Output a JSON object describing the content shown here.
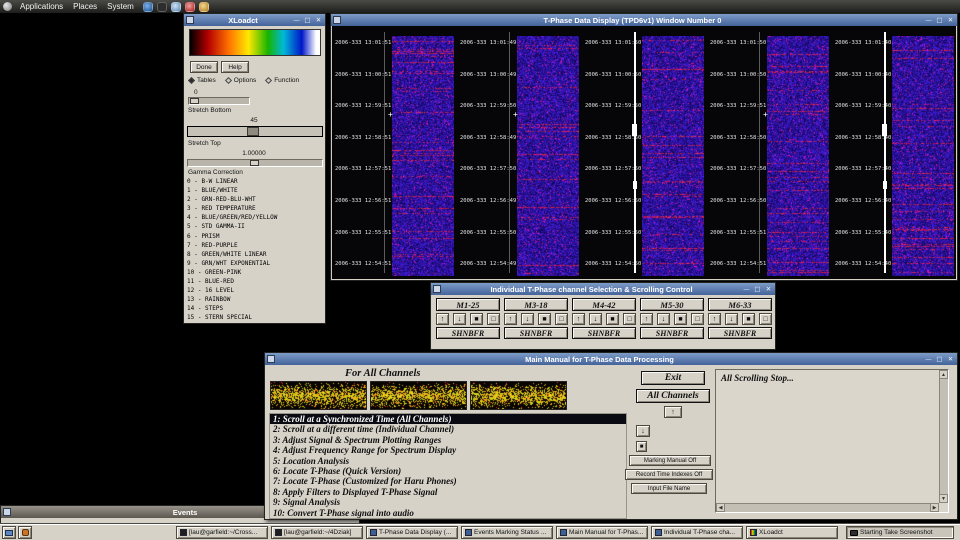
{
  "colors": {
    "titlebar_active": "#43639a",
    "titlebar_inactive": "#6e6a62",
    "window_bg": "#d6d2c8",
    "desktop": "#000000",
    "selection_bg": "#0a0a12",
    "spectrogram_base": "#2020a0",
    "spectrogram_hot": "#cc2040"
  },
  "icons": {
    "minimize": "—",
    "maximize": "□",
    "close": "✕",
    "up": "↑",
    "down": "↓",
    "stop": "■",
    "square": "□",
    "scroll_up": "▲",
    "scroll_down": "▼",
    "scroll_left": "◀",
    "scroll_right": "▶"
  },
  "menubar": {
    "menus": [
      "Applications",
      "Places",
      "System"
    ]
  },
  "xloadct": {
    "title": "XLoadct",
    "done_label": "Done",
    "help_label": "Help",
    "radio_tables": "Tables",
    "radio_options": "Options",
    "radio_function": "Function",
    "stretch_bottom_value": "0",
    "stretch_bottom_label": "Stretch Bottom",
    "stretch_top_value": "45",
    "stretch_top_label": "Stretch Top",
    "gamma_value": "1.00000",
    "gamma_label": "Gamma Correction",
    "color_tables": [
      "0 - B-W LINEAR",
      "1 - BLUE/WHITE",
      "2 - GRN-RED-BLU-WHT",
      "3 - RED TEMPERATURE",
      "4 - BLUE/GREEN/RED/YELLOW",
      "5 - STD GAMMA-II",
      "6 - PRISM",
      "7 - RED-PURPLE",
      "8 - GREEN/WHITE LINEAR",
      "9 - GRN/WHT EXPONENTIAL",
      "10 - GREEN-PINK",
      "11 - BLUE-RED",
      "12 - 16 LEVEL",
      "13 - RAINBOW",
      "14 - STEPS",
      "15 - STERN SPECIAL"
    ]
  },
  "tpd": {
    "title": "T-Phase Data Display (TPD6v1) Window Number 0",
    "channels": [
      {
        "times": [
          "2006-333 13:01:51",
          "2006-333 13:00:51",
          "2006-333 12:59:51",
          "2006-333 12:58:51",
          "2006-333 12:57:51",
          "2006-333 12:56:51",
          "2006-333 12:55:51",
          "2006-333 12:54:51"
        ]
      },
      {
        "times": [
          "2006-333 13:01:49",
          "2006-333 13:00:49",
          "2006-333 12:59:50",
          "2006-333 12:58:49",
          "2006-333 12:57:50",
          "2006-333 12:56:49",
          "2006-333 12:55:50",
          "2006-333 12:54:49"
        ]
      },
      {
        "times": [
          "2006-333 13:01:50",
          "2006-333 13:00:50",
          "2006-333 12:59:50",
          "2006-333 12:58:50",
          "2006-333 12:57:50",
          "2006-333 12:56:50",
          "2006-333 12:55:50",
          "2006-333 12:54:50"
        ]
      },
      {
        "times": [
          "2006-333 13:01:50",
          "2006-333 13:00:50",
          "2006-333 12:59:51",
          "2006-333 12:58:50",
          "2006-333 12:57:50",
          "2006-333 12:56:50",
          "2006-333 12:55:51",
          "2006-333 12:54:51"
        ]
      },
      {
        "times": [
          "2006-333 13:01:40",
          "2006-333 13:00:40",
          "2006-333 12:59:40",
          "2006-333 12:58:40",
          "2006-333 12:57:40",
          "2006-333 12:56:40",
          "2006-333 12:55:40",
          "2006-333 12:54:40"
        ]
      }
    ]
  },
  "scroller": {
    "title": "Individual T-Phase channel Selection & Scrolling Control",
    "channels": [
      {
        "name": "M1-25",
        "filter": "SHNBFR"
      },
      {
        "name": "M3-18",
        "filter": "SHNBFR"
      },
      {
        "name": "M4-42",
        "filter": "SHNBFR"
      },
      {
        "name": "M5-30",
        "filter": "SHNBFR"
      },
      {
        "name": "M6-33",
        "filter": "SHNBFR"
      }
    ]
  },
  "manual": {
    "title": "Main Manual for T-Phase Data Processing",
    "header": "For All Channels",
    "exit_label": "Exit",
    "all_channels_label": "All Channels",
    "status_text": "All Scrolling Stop...",
    "menu_items": [
      "1: Scroll at a Synchronized Time (All Channels)",
      "2: Scroll at a different time (Individual Channel)",
      "3: Adjust Signal & Spectrum Plotting Ranges",
      "4: Adjust Frequency Range for Spectrum Display",
      "5: Location Analysis",
      "6: Locate T-Phase (Quick Version)",
      "7: Locate T-Phase (Customized for Haru Phones)",
      "8: Apply Filters to Displayed T-Phase Signal",
      "9: Signal Analysis",
      "10: Convert T-Phase signal into audio"
    ],
    "selected_index": 0,
    "marking_label": "Marking Manual Off",
    "record_label": "Record Time Indexes Off",
    "input_label": "Input File Name"
  },
  "events": {
    "title": "Events"
  },
  "taskbar": {
    "items": [
      "[lau@garfield:~/Cross...",
      "[lau@garfield:~/4Dziak]",
      "T-Phase Data Display (...",
      "Events Marking Status ...",
      "Main Manual for T-Phas...",
      "Individual T-Phase cha...",
      "XLoadct"
    ],
    "screenshot_label": "Starting Take Screenshot"
  }
}
